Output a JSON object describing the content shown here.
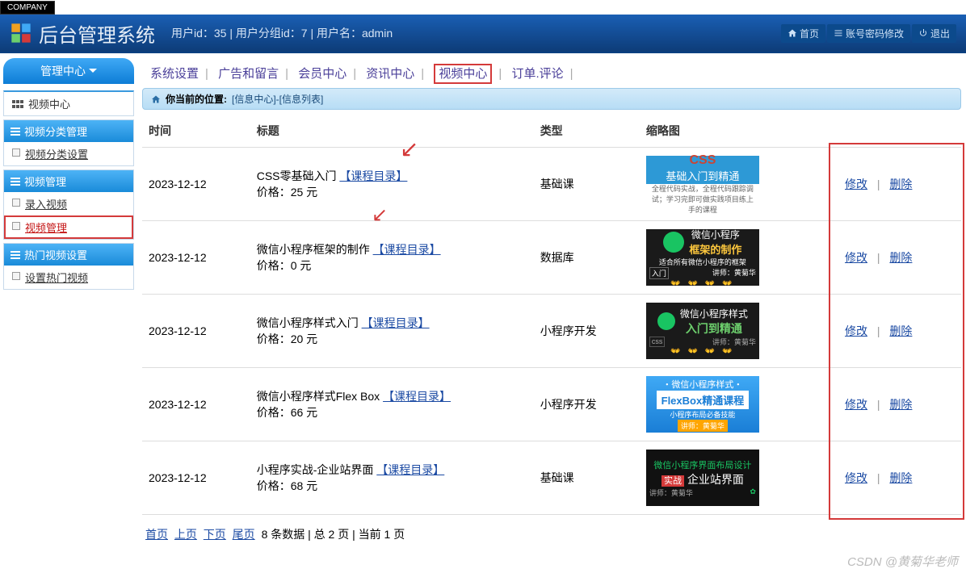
{
  "company_tag": "COMPANY",
  "header": {
    "title": "后台管理系统",
    "user_info": "用户id：35 | 用户分组id：7 | 用户名：admin",
    "home": "首页",
    "pwd": "账号密码修改",
    "logout": "退出"
  },
  "left_tab": "管理中心",
  "left_sub": "视频中心",
  "menu": {
    "g1": {
      "title": "视频分类管理",
      "items": [
        "视频分类设置"
      ]
    },
    "g2": {
      "title": "视频管理",
      "items": [
        "录入视频",
        "视频管理"
      ]
    },
    "g3": {
      "title": "热门视频设置",
      "items": [
        "设置热门视频"
      ]
    }
  },
  "top_nav": [
    "系统设置",
    "广告和留言",
    "会员中心",
    "资讯中心",
    "视频中心",
    "订单.评论"
  ],
  "breadcrumb": {
    "label": "你当前的位置:",
    "loc": "[信息中心]-[信息列表]"
  },
  "table": {
    "headers": {
      "time": "时间",
      "title": "标题",
      "type": "类型",
      "thumb": "缩略图"
    },
    "rows": [
      {
        "time": "2023-12-12",
        "title_pre": "CSS零基础入门",
        "catalog": "【课程目录】",
        "price_label": "价格：",
        "price": "25 元",
        "type": "基础课",
        "thumb": {
          "style": "1",
          "line1": "CSS",
          "line2": "基础入门到精通",
          "line3": "全程代码实战，全程代码跟踪调试；学习完即可做实践项目练上手的课程"
        }
      },
      {
        "time": "2023-12-12",
        "title_pre": "微信小程序框架的制作",
        "catalog": "【课程目录】",
        "price_label": "价格：",
        "price": "0 元",
        "type": "数据库",
        "thumb": {
          "style": "2",
          "line1": "微信小程序",
          "line2": "框架的制作",
          "line3": "适合所有微信小程序的框架",
          "line4": "讲师：黄菊华",
          "tag": "入门"
        }
      },
      {
        "time": "2023-12-12",
        "title_pre": "微信小程序样式入门",
        "catalog": "【课程目录】",
        "price_label": "价格：",
        "price": "20 元",
        "type": "小程序开发",
        "thumb": {
          "style": "3",
          "line1": "微信小程序样式",
          "line2": "入门到精通",
          "line3": "讲师：黄菊华",
          "tag": "css"
        }
      },
      {
        "time": "2023-12-12",
        "title_pre": "微信小程序样式Flex Box",
        "catalog": "【课程目录】",
        "price_label": "价格：",
        "price": "66 元",
        "type": "小程序开发",
        "thumb": {
          "style": "4",
          "line1": "・微信小程序样式・",
          "line2": "FlexBox精通课程",
          "line3": "小程序布局必备技能",
          "line4": "讲师：黄菊华"
        }
      },
      {
        "time": "2023-12-12",
        "title_pre": "小程序实战-企业站界面",
        "catalog": "【课程目录】",
        "price_label": "价格：",
        "price": "68 元",
        "type": "基础课",
        "thumb": {
          "style": "5",
          "line1": "微信小程序界面布局设计",
          "badge": "实战",
          "line2": "企业站界面",
          "line3": "讲师：黄菊华"
        }
      }
    ],
    "actions": {
      "edit": "修改",
      "del": "删除"
    }
  },
  "pager": {
    "first": "首页",
    "prev": "上页",
    "next": "下页",
    "last": "尾页",
    "info": "8 条数据 | 总 2 页 | 当前 1 页"
  },
  "watermark": "CSDN @黄菊华老师"
}
